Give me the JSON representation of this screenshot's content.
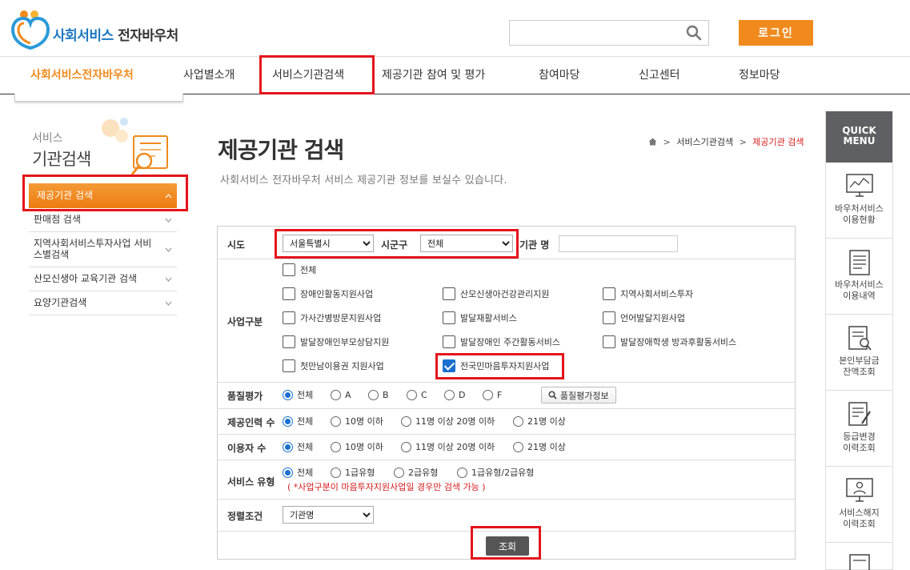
{
  "header": {
    "logo_blue": "사회서비스",
    "logo_dark": "전자바우처",
    "login_label": "로그인",
    "search_placeholder": ""
  },
  "gnb": {
    "items": [
      "사회서비스전자바우처",
      "사업별소개",
      "서비스기관검색",
      "제공기관 참여 및 평가",
      "참여마당",
      "신고센터",
      "정보마당"
    ]
  },
  "sidebar": {
    "title_small": "서비스",
    "title_large": "기관검색",
    "items": [
      "제공기관 검색",
      "판매점 검색",
      "지역사회서비스투자사업 서비스별검색",
      "산모신생아 교육기관 검색",
      "요양기관검색"
    ]
  },
  "main": {
    "title": "제공기관 검색",
    "description": "사회서비스 전자바우처 서비스 제공기관 정보를 보실수 있습니다.",
    "breadcrumb": [
      "서비스기관검색",
      "제공기관 검색"
    ]
  },
  "form": {
    "sido_label": "시도",
    "sido_value": "서울특별시",
    "sigungu_label": "시군구",
    "sigungu_value": "전체",
    "agency_label": "기관 명",
    "agency_value": "",
    "business_label": "사업구분",
    "business_all": "전체",
    "business_items": [
      "장애인활동지원사업",
      "산모신생아건강관리지원",
      "지역사회서비스투자",
      "가사간병방문지원사업",
      "발달재활서비스",
      "언어발달지원사업",
      "발달장애인부모상담지원",
      "발달장애인 주간활동서비스",
      "발달장애학생 방과후활동서비스",
      "첫만남이용권 지원사업",
      "전국민마음투자지원사업"
    ],
    "business_checked": "전국민마음투자지원사업",
    "quality_label": "품질평가",
    "quality_options": [
      "전체",
      "A",
      "B",
      "C",
      "D",
      "F"
    ],
    "quality_button": "품질평가정보",
    "staff_label": "제공인력 수",
    "staff_options": [
      "전체",
      "10명 이하",
      "11명 이상 20명 이하",
      "21명 이상"
    ],
    "users_label": "이용자 수",
    "users_options": [
      "전체",
      "10명 이하",
      "11명 이상 20명 이하",
      "21명 이상"
    ],
    "type_label": "서비스 유형",
    "type_options": [
      "전체",
      "1급유형",
      "2급유형",
      "1급유형/2급유형"
    ],
    "type_note": "( *사업구분이 마음투자지원사업일 경우만 검색 가능 )",
    "sort_label": "정렬조건",
    "sort_value": "기관명",
    "submit": "조회"
  },
  "quick": {
    "title_1": "QUICK",
    "title_2": "MENU",
    "items": [
      {
        "line1": "바우처서비스",
        "line2": "이용현황",
        "icon": "monitor-chart-icon"
      },
      {
        "line1": "바우처서비스",
        "line2": "이용내역",
        "icon": "document-list-icon"
      },
      {
        "line1": "본인부담금",
        "line2": "잔액조회",
        "icon": "document-search-icon"
      },
      {
        "line1": "등급변경",
        "line2": "이력조회",
        "icon": "document-pen-icon"
      },
      {
        "line1": "서비스해지",
        "line2": "이력조회",
        "icon": "monitor-user-icon"
      }
    ]
  },
  "colors": {
    "accent_orange": "#f08a1d",
    "brand_blue": "#1b76c0",
    "highlight_red": "#e4141b",
    "quick_header": "#5f6064"
  }
}
